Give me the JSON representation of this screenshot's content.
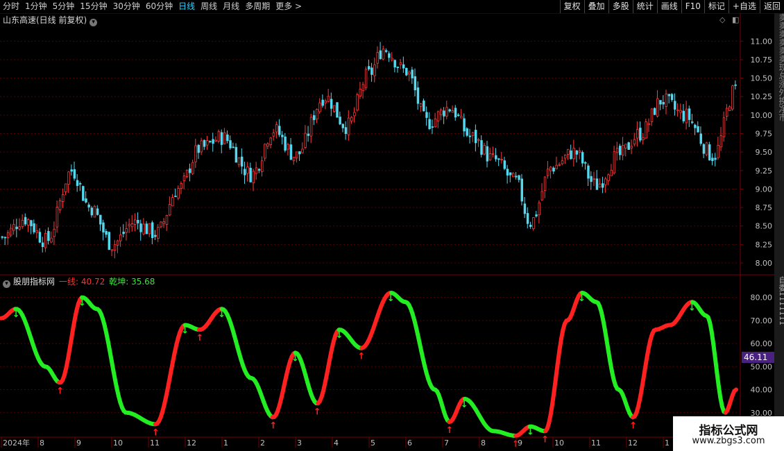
{
  "toolbar": {
    "periods": [
      "分时",
      "1分钟",
      "5分钟",
      "15分钟",
      "30分钟",
      "60分钟",
      "日线",
      "周线",
      "月线",
      "多周期",
      "更多 >"
    ],
    "active_period": "日线",
    "right_buttons": [
      "复权",
      "叠加",
      "多股",
      "统计",
      "画线",
      "F10",
      "标记",
      "+自选",
      "返回"
    ]
  },
  "main_chart": {
    "title": "山东高速(日线 前复权)",
    "y_ticks": [
      "11.00",
      "10.75",
      "10.50",
      "10.25",
      "10.00",
      "9.75",
      "9.50",
      "9.25",
      "9.00",
      "8.75",
      "8.50",
      "8.25",
      "8.00"
    ],
    "ylim": [
      7.85,
      11.2
    ],
    "side_text": "卖卖卖卖卖卖现总涨外换净市"
  },
  "indicator": {
    "name": "股朋指标网",
    "line1_label": "一线: 40.72",
    "line2_label": "乾坤: 35.68",
    "y_ticks": [
      "80.00",
      "70.00",
      "60.00",
      "50.00",
      "40.00",
      "30.00"
    ],
    "ylim": [
      20,
      85
    ],
    "current_badge": "46.11",
    "side_text": "自委1111111"
  },
  "x_axis": {
    "labels": [
      "2024年",
      "8",
      "9",
      "10",
      "11",
      "12",
      "1",
      "2",
      "3",
      "4",
      "5",
      "6",
      "7",
      "8",
      "9",
      "10",
      "11",
      "12",
      "1"
    ]
  },
  "watermark": {
    "line1": "指标公式网",
    "line2": "www.zbgs3.com"
  },
  "colors": {
    "up": "#ff3b3b",
    "down": "#54d8f0",
    "grid": "#5a0000",
    "ind_up": "#ff2020",
    "ind_down": "#22ee22",
    "axis_text": "#c0c0c0"
  },
  "chart_data": [
    {
      "type": "candlestick",
      "title": "山东高速(日线 前复权)",
      "ylim": [
        7.85,
        11.2
      ],
      "close_keypoints": [
        {
          "t": 0.0,
          "v": 8.35
        },
        {
          "t": 0.03,
          "v": 8.6
        },
        {
          "t": 0.06,
          "v": 8.3
        },
        {
          "t": 0.095,
          "v": 9.25
        },
        {
          "t": 0.12,
          "v": 8.75
        },
        {
          "t": 0.15,
          "v": 8.25
        },
        {
          "t": 0.18,
          "v": 8.55
        },
        {
          "t": 0.21,
          "v": 8.4
        },
        {
          "t": 0.24,
          "v": 9.0
        },
        {
          "t": 0.27,
          "v": 9.55
        },
        {
          "t": 0.3,
          "v": 9.7
        },
        {
          "t": 0.34,
          "v": 9.2
        },
        {
          "t": 0.37,
          "v": 9.8
        },
        {
          "t": 0.4,
          "v": 9.45
        },
        {
          "t": 0.44,
          "v": 10.25
        },
        {
          "t": 0.47,
          "v": 9.85
        },
        {
          "t": 0.5,
          "v": 10.55
        },
        {
          "t": 0.52,
          "v": 10.9
        },
        {
          "t": 0.55,
          "v": 10.6
        },
        {
          "t": 0.58,
          "v": 9.9
        },
        {
          "t": 0.61,
          "v": 10.1
        },
        {
          "t": 0.64,
          "v": 9.7
        },
        {
          "t": 0.67,
          "v": 9.4
        },
        {
          "t": 0.7,
          "v": 9.1
        },
        {
          "t": 0.72,
          "v": 8.55
        },
        {
          "t": 0.75,
          "v": 9.3
        },
        {
          "t": 0.78,
          "v": 9.5
        },
        {
          "t": 0.81,
          "v": 9.05
        },
        {
          "t": 0.84,
          "v": 9.45
        },
        {
          "t": 0.87,
          "v": 9.75
        },
        {
          "t": 0.9,
          "v": 10.2
        },
        {
          "t": 0.93,
          "v": 10.0
        },
        {
          "t": 0.97,
          "v": 9.45
        },
        {
          "t": 1.0,
          "v": 10.35
        }
      ]
    },
    {
      "type": "line",
      "title": "股朋指标网",
      "ylim": [
        20,
        85
      ],
      "series": [
        {
          "name": "一线",
          "keypoints": [
            {
              "t": 0.0,
              "v": 71
            },
            {
              "t": 0.02,
              "v": 75
            },
            {
              "t": 0.06,
              "v": 50
            },
            {
              "t": 0.08,
              "v": 43
            },
            {
              "t": 0.11,
              "v": 80
            },
            {
              "t": 0.13,
              "v": 75
            },
            {
              "t": 0.17,
              "v": 30
            },
            {
              "t": 0.21,
              "v": 25
            },
            {
              "t": 0.25,
              "v": 68
            },
            {
              "t": 0.27,
              "v": 66
            },
            {
              "t": 0.3,
              "v": 75
            },
            {
              "t": 0.34,
              "v": 45
            },
            {
              "t": 0.37,
              "v": 28
            },
            {
              "t": 0.4,
              "v": 56
            },
            {
              "t": 0.43,
              "v": 34
            },
            {
              "t": 0.46,
              "v": 66
            },
            {
              "t": 0.49,
              "v": 58
            },
            {
              "t": 0.53,
              "v": 82
            },
            {
              "t": 0.55,
              "v": 78
            },
            {
              "t": 0.59,
              "v": 40
            },
            {
              "t": 0.61,
              "v": 26
            },
            {
              "t": 0.63,
              "v": 36
            },
            {
              "t": 0.67,
              "v": 22
            },
            {
              "t": 0.7,
              "v": 20
            },
            {
              "t": 0.72,
              "v": 24
            },
            {
              "t": 0.74,
              "v": 22
            },
            {
              "t": 0.77,
              "v": 70
            },
            {
              "t": 0.79,
              "v": 82
            },
            {
              "t": 0.81,
              "v": 78
            },
            {
              "t": 0.84,
              "v": 40
            },
            {
              "t": 0.86,
              "v": 28
            },
            {
              "t": 0.89,
              "v": 66
            },
            {
              "t": 0.91,
              "v": 68
            },
            {
              "t": 0.94,
              "v": 78
            },
            {
              "t": 0.96,
              "v": 72
            },
            {
              "t": 0.985,
              "v": 30
            },
            {
              "t": 1.0,
              "v": 40
            }
          ]
        }
      ]
    }
  ]
}
